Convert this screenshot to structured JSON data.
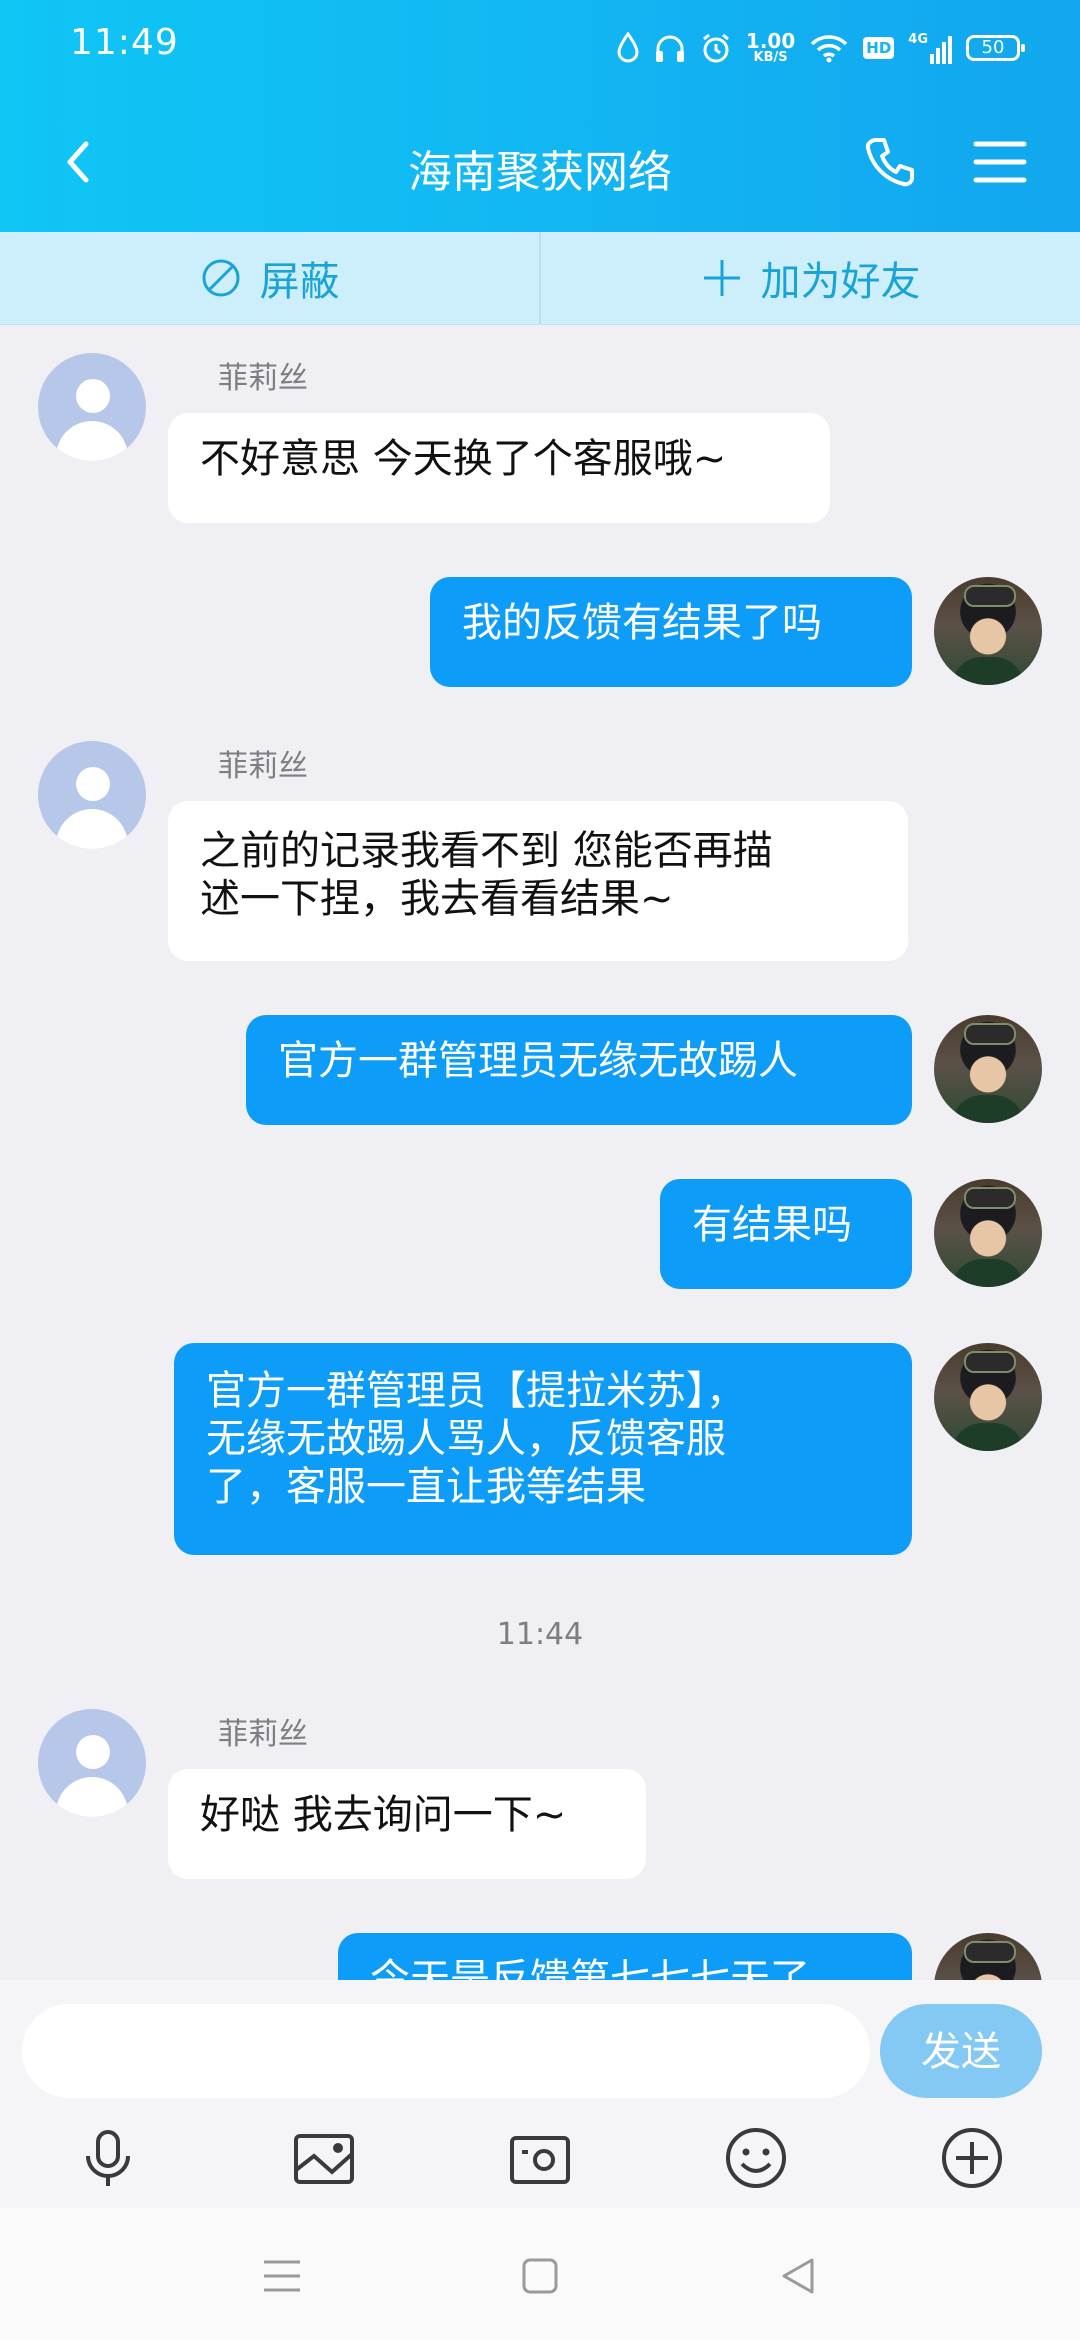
{
  "status_bar": {
    "time": "11:49",
    "net_speed_value": "1.00",
    "net_speed_unit": "KB/S",
    "hd_label": "HD",
    "signal_label": "4G",
    "battery": "50"
  },
  "header": {
    "title": "海南聚获网络"
  },
  "actions": {
    "block_label": "屏蔽",
    "add_friend_label": "加为好友"
  },
  "messages": [
    {
      "direction": "in",
      "sender": "菲莉丝",
      "text": "不好意思 今天换了个客服哦~"
    },
    {
      "direction": "out",
      "text": "我的反馈有结果了吗"
    },
    {
      "direction": "in",
      "sender": "菲莉丝",
      "text_lines": [
        "之前的记录我看不到 您能否再描",
        "述一下捏，我去看看结果~"
      ]
    },
    {
      "direction": "out",
      "text": "官方一群管理员无缘无故踢人"
    },
    {
      "direction": "out",
      "text": "有结果吗"
    },
    {
      "direction": "out",
      "text_lines": [
        "官方一群管理员【提拉米苏】，",
        "无缘无故踢人骂人，反馈客服",
        "了，客服一直让我等结果"
      ]
    },
    {
      "direction": "in",
      "sender": "菲莉丝",
      "text": "好哒 我去询问一下~"
    },
    {
      "direction": "out",
      "text": "今天是反馈第七七七天了"
    }
  ],
  "timestamp": "11:44",
  "input": {
    "placeholder": "",
    "send_label": "发送"
  },
  "colors": {
    "header_gradient_start": "#0fc6f5",
    "header_gradient_end": "#12a6ee",
    "outgoing_bubble": "#0d9cf7",
    "incoming_bubble": "#ffffff",
    "send_button": "#83c9f4"
  },
  "icons": {
    "toolbar": [
      "microphone-icon",
      "image-icon",
      "camera-icon",
      "emoji-icon",
      "plus-icon"
    ],
    "system_nav": [
      "recent-apps-icon",
      "home-icon",
      "back-icon"
    ]
  }
}
